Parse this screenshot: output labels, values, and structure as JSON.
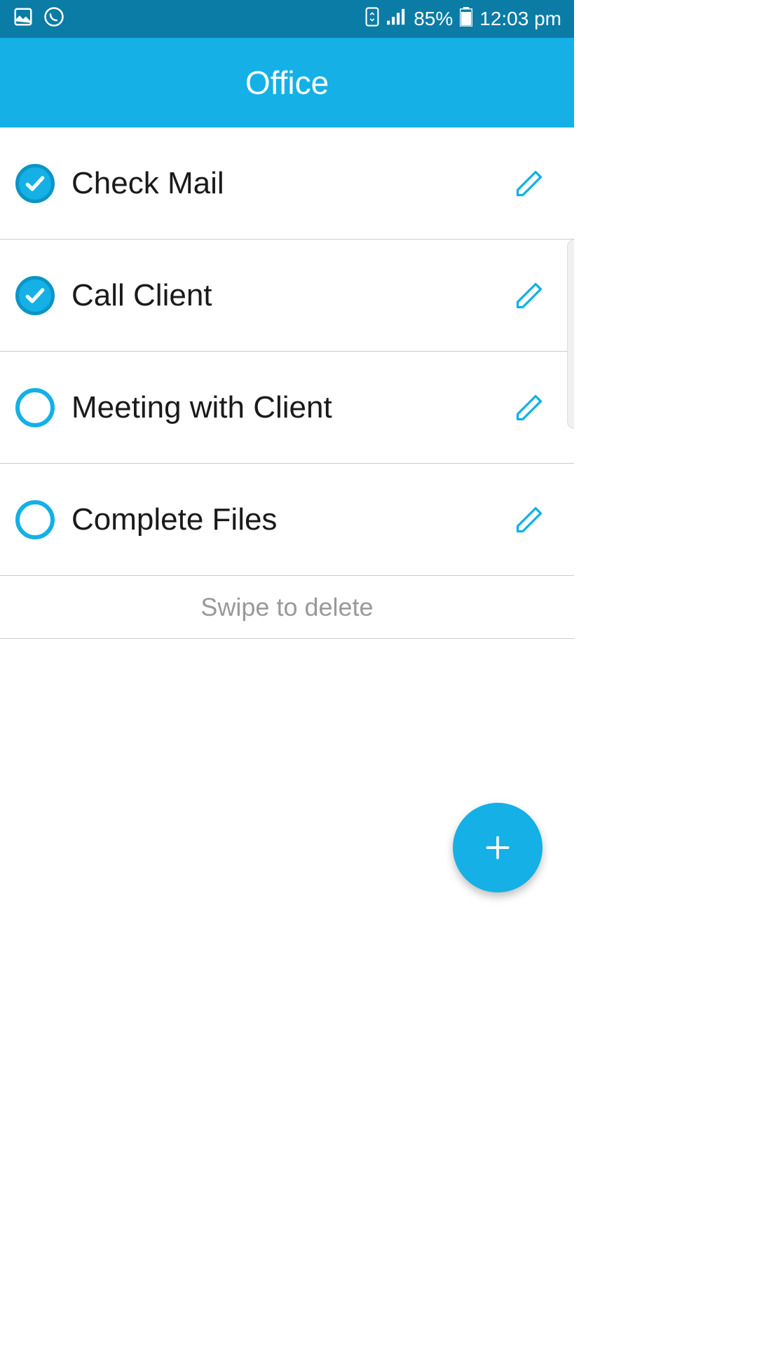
{
  "status": {
    "battery": "85%",
    "time": "12:03 pm"
  },
  "header": {
    "title": "Office"
  },
  "tasks": [
    {
      "label": "Check Mail",
      "checked": true
    },
    {
      "label": "Call Client",
      "checked": true
    },
    {
      "label": "Meeting with Client",
      "checked": false
    },
    {
      "label": "Complete Files",
      "checked": false
    }
  ],
  "hint": "Swipe to delete"
}
